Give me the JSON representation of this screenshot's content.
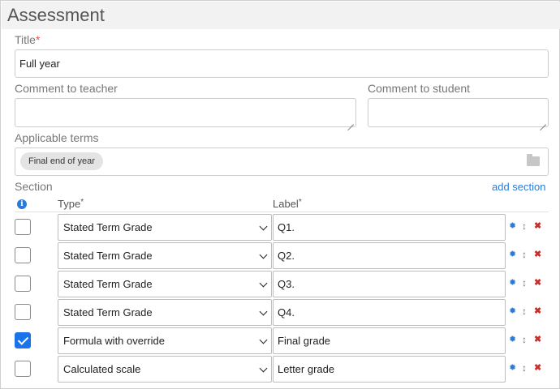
{
  "header": {
    "title": "Assessment"
  },
  "form": {
    "title_label": "Title",
    "title_required": "*",
    "title_value": "Full year",
    "comment_teacher_label": "Comment to teacher",
    "comment_student_label": "Comment to student",
    "terms_label": "Applicable terms",
    "terms_tag": "Final end of year",
    "section_label": "Section",
    "add_section": "add section"
  },
  "table": {
    "info_glyph": "i",
    "type_header": "Type",
    "label_header": "Label",
    "required_mark": "*",
    "rows": [
      {
        "checked": false,
        "type": "Stated Term Grade",
        "label": "Q1."
      },
      {
        "checked": false,
        "type": "Stated Term Grade",
        "label": "Q2."
      },
      {
        "checked": false,
        "type": "Stated Term Grade",
        "label": "Q3."
      },
      {
        "checked": false,
        "type": "Stated Term Grade",
        "label": "Q4."
      },
      {
        "checked": true,
        "type": "Formula with override",
        "label": "Final grade"
      },
      {
        "checked": false,
        "type": "Calculated scale",
        "label": "Letter grade"
      }
    ]
  },
  "icons": {
    "settings": "gear-icon",
    "move": "move-icon",
    "delete": "delete-icon",
    "folder": "folder-icon",
    "info": "info-icon"
  },
  "colors": {
    "accent": "#2b7bd6",
    "checkbox_checked": "#1a73e8",
    "delete": "#c9302c",
    "required": "#d9534f"
  }
}
